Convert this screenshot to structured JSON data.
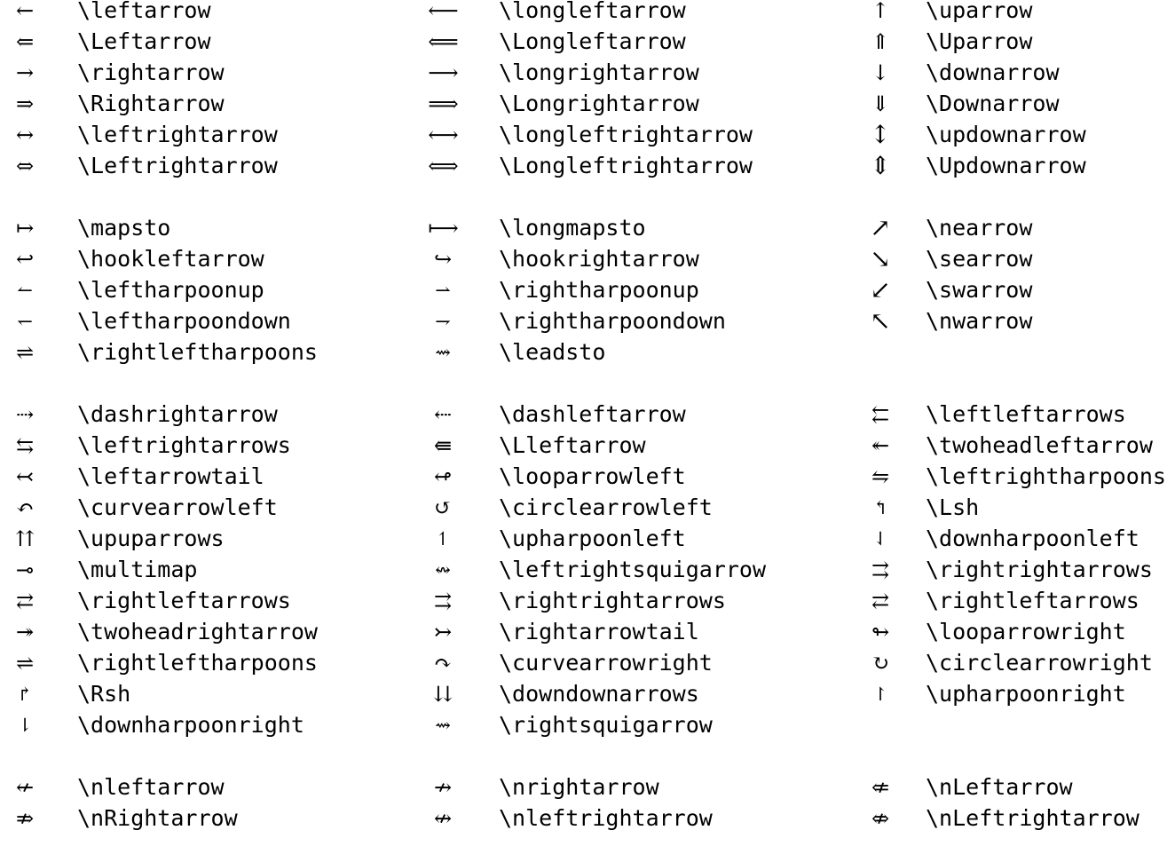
{
  "groups": [
    {
      "rows": [
        [
          {
            "symbol": "←",
            "command": "\\leftarrow"
          },
          {
            "symbol": "⟵",
            "command": "\\longleftarrow"
          },
          {
            "symbol": "↑",
            "command": "\\uparrow"
          }
        ],
        [
          {
            "symbol": "⇐",
            "command": "\\Leftarrow"
          },
          {
            "symbol": "⟸",
            "command": "\\Longleftarrow"
          },
          {
            "symbol": "⇑",
            "command": "\\Uparrow"
          }
        ],
        [
          {
            "symbol": "→",
            "command": "\\rightarrow"
          },
          {
            "symbol": "⟶",
            "command": "\\longrightarrow"
          },
          {
            "symbol": "↓",
            "command": "\\downarrow"
          }
        ],
        [
          {
            "symbol": "⇒",
            "command": "\\Rightarrow"
          },
          {
            "symbol": "⟹",
            "command": "\\Longrightarrow"
          },
          {
            "symbol": "⇓",
            "command": "\\Downarrow"
          }
        ],
        [
          {
            "symbol": "↔",
            "command": "\\leftrightarrow"
          },
          {
            "symbol": "⟷",
            "command": "\\longleftrightarrow"
          },
          {
            "symbol": "↕",
            "command": "\\updownarrow"
          }
        ],
        [
          {
            "symbol": "⇔",
            "command": "\\Leftrightarrow"
          },
          {
            "symbol": "⟺",
            "command": "\\Longleftrightarrow"
          },
          {
            "symbol": "⇕",
            "command": "\\Updownarrow"
          }
        ]
      ]
    },
    {
      "rows": [
        [
          {
            "symbol": "↦",
            "command": "\\mapsto"
          },
          {
            "symbol": "⟼",
            "command": "\\longmapsto"
          },
          {
            "symbol": "↗",
            "command": "\\nearrow"
          }
        ],
        [
          {
            "symbol": "↩",
            "command": "\\hookleftarrow"
          },
          {
            "symbol": "↪",
            "command": "\\hookrightarrow"
          },
          {
            "symbol": "↘",
            "command": "\\searrow"
          }
        ],
        [
          {
            "symbol": "↼",
            "command": "\\leftharpoonup"
          },
          {
            "symbol": "⇀",
            "command": "\\rightharpoonup"
          },
          {
            "symbol": "↙",
            "command": "\\swarrow"
          }
        ],
        [
          {
            "symbol": "↽",
            "command": "\\leftharpoondown"
          },
          {
            "symbol": "⇁",
            "command": "\\rightharpoondown"
          },
          {
            "symbol": "↖",
            "command": "\\nwarrow"
          }
        ],
        [
          {
            "symbol": "⇌",
            "command": "\\rightleftharpoons"
          },
          {
            "symbol": "⇝",
            "command": "\\leadsto"
          },
          null
        ]
      ]
    },
    {
      "rows": [
        [
          {
            "symbol": "⇢",
            "command": "\\dashrightarrow"
          },
          {
            "symbol": "⇠",
            "command": "\\dashleftarrow"
          },
          {
            "symbol": "⇇",
            "command": "\\leftleftarrows"
          }
        ],
        [
          {
            "symbol": "⇆",
            "command": "\\leftrightarrows"
          },
          {
            "symbol": "⇚",
            "command": "\\Lleftarrow"
          },
          {
            "symbol": "↞",
            "command": "\\twoheadleftarrow"
          }
        ],
        [
          {
            "symbol": "↢",
            "command": "\\leftarrowtail"
          },
          {
            "symbol": "↫",
            "command": "\\looparrowleft"
          },
          {
            "symbol": "⇋",
            "command": "\\leftrightharpoons"
          }
        ],
        [
          {
            "symbol": "↶",
            "command": "\\curvearrowleft"
          },
          {
            "symbol": "↺",
            "command": "\\circlearrowleft"
          },
          {
            "symbol": "↰",
            "command": "\\Lsh"
          }
        ],
        [
          {
            "symbol": "⇈",
            "command": "\\upuparrows"
          },
          {
            "symbol": "↿",
            "command": "\\upharpoonleft"
          },
          {
            "symbol": "⇃",
            "command": "\\downharpoonleft"
          }
        ],
        [
          {
            "symbol": "⊸",
            "command": "\\multimap"
          },
          {
            "symbol": "↭",
            "command": "\\leftrightsquigarrow"
          },
          {
            "symbol": "⇉",
            "command": "\\rightrightarrows"
          }
        ],
        [
          {
            "symbol": "⇄",
            "command": "\\rightleftarrows"
          },
          {
            "symbol": "⇉",
            "command": "\\rightrightarrows"
          },
          {
            "symbol": "⇄",
            "command": "\\rightleftarrows"
          }
        ],
        [
          {
            "symbol": "↠",
            "command": "\\twoheadrightarrow"
          },
          {
            "symbol": "↣",
            "command": "\\rightarrowtail"
          },
          {
            "symbol": "↬",
            "command": "\\looparrowright"
          }
        ],
        [
          {
            "symbol": "⇌",
            "command": "\\rightleftharpoons"
          },
          {
            "symbol": "↷",
            "command": "\\curvearrowright"
          },
          {
            "symbol": "↻",
            "command": "\\circlearrowright"
          }
        ],
        [
          {
            "symbol": "↱",
            "command": "\\Rsh"
          },
          {
            "symbol": "⇊",
            "command": "\\downdownarrows"
          },
          {
            "symbol": "↾",
            "command": "\\upharpoonright"
          }
        ],
        [
          {
            "symbol": "⇂",
            "command": "\\downharpoonright"
          },
          {
            "symbol": "⇝",
            "command": "\\rightsquigarrow"
          },
          null
        ]
      ]
    },
    {
      "rows": [
        [
          {
            "symbol": "↚",
            "command": "\\nleftarrow"
          },
          {
            "symbol": "↛",
            "command": "\\nrightarrow"
          },
          {
            "symbol": "⇍",
            "command": "\\nLeftarrow"
          }
        ],
        [
          {
            "symbol": "⇏",
            "command": "\\nRightarrow"
          },
          {
            "symbol": "↮",
            "command": "\\nleftrightarrow"
          },
          {
            "symbol": "⇎",
            "command": "\\nLeftrightarrow"
          }
        ]
      ]
    }
  ]
}
